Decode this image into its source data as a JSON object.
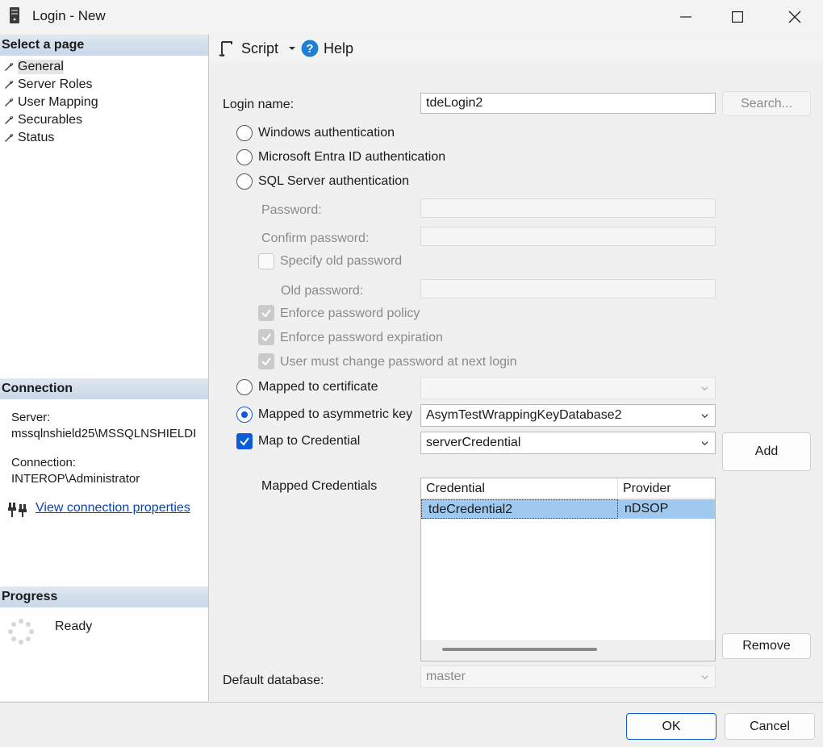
{
  "window": {
    "title": "Login - New"
  },
  "left": {
    "select_page_header": "Select a page",
    "pages": [
      "General",
      "Server Roles",
      "User Mapping",
      "Securables",
      "Status"
    ],
    "connection_header": "Connection",
    "server_label": "Server:",
    "server_value": "mssqlnshield25\\MSSQLNSHIELDI",
    "connection_label": "Connection:",
    "connection_value": "INTEROP\\Administrator",
    "view_link": "View connection properties",
    "progress_header": "Progress",
    "progress_status": "Ready"
  },
  "toolbar": {
    "script": "Script",
    "help": "Help"
  },
  "form": {
    "login_name_label": "Login name:",
    "login_name_value": "tdeLogin2",
    "search_button": "Search...",
    "windows_auth": "Windows authentication",
    "entra_auth": "Microsoft Entra ID authentication",
    "sql_auth": "SQL Server authentication",
    "password_label": "Password:",
    "confirm_password_label": "Confirm password:",
    "specify_old_password": "Specify old password",
    "old_password_label": "Old password:",
    "enforce_policy": "Enforce password policy",
    "enforce_expiration": "Enforce password expiration",
    "must_change": "User must change password at next login",
    "mapped_certificate": "Mapped to certificate",
    "certificate_value": "",
    "mapped_asym_key": "Mapped to asymmetric key",
    "asym_key_value": "AsymTestWrappingKeyDatabase2",
    "map_credential": "Map to Credential",
    "credential_value": "serverCredential",
    "add_button": "Add",
    "mapped_credentials_label": "Mapped Credentials",
    "grid_headers": [
      "Credential",
      "Provider"
    ],
    "grid_rows": [
      {
        "credential": "tdeCredential2",
        "provider": "nDSOP"
      }
    ],
    "remove_button": "Remove",
    "default_db_label": "Default database:",
    "default_db_value": "master"
  },
  "footer": {
    "ok": "OK",
    "cancel": "Cancel"
  },
  "colors": {
    "accent": "#0b5cd7",
    "selection": "#9fc9ee",
    "header": "#c9d7e8"
  }
}
